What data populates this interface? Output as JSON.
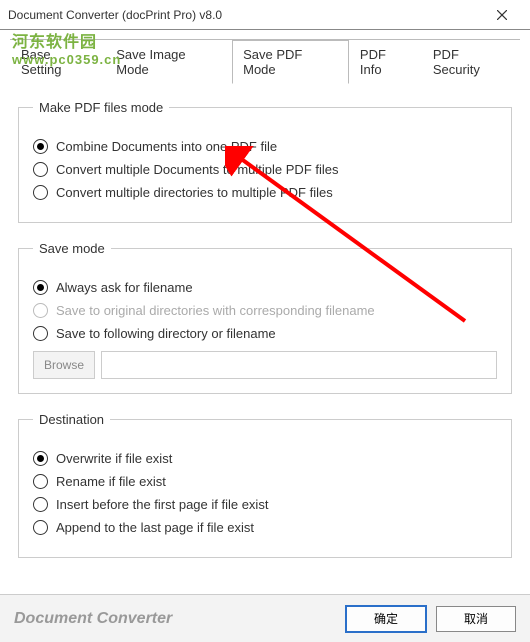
{
  "window": {
    "title": "Document Converter (docPrint Pro) v8.0"
  },
  "watermark": {
    "line1": "河东软件园",
    "line2": "www.pc0359.cn"
  },
  "tabs": {
    "items": [
      {
        "label": "Base Setting"
      },
      {
        "label": "Save Image Mode"
      },
      {
        "label": "Save PDF Mode"
      },
      {
        "label": "PDF Info"
      },
      {
        "label": "PDF Security"
      }
    ],
    "active_index": 2
  },
  "groups": {
    "makePdf": {
      "legend": "Make PDF files mode",
      "options": [
        "Combine Documents into one PDF file",
        "Convert multiple Documents to multiple PDF files",
        "Convert multiple directories to multiple PDF files"
      ],
      "selected": 0
    },
    "saveMode": {
      "legend": "Save mode",
      "options": [
        "Always ask for filename",
        "Save to original directories with corresponding filename",
        "Save to following directory or filename"
      ],
      "selected": 0,
      "disabled_index": 1,
      "browse_label": "Browse",
      "path": ""
    },
    "destination": {
      "legend": "Destination",
      "options": [
        "Overwrite if file exist",
        "Rename if file exist",
        "Insert before the first page if file exist",
        "Append to the last page if file exist"
      ],
      "selected": 0
    }
  },
  "footer": {
    "brand": "Document Converter",
    "ok": "确定",
    "cancel": "取消"
  }
}
